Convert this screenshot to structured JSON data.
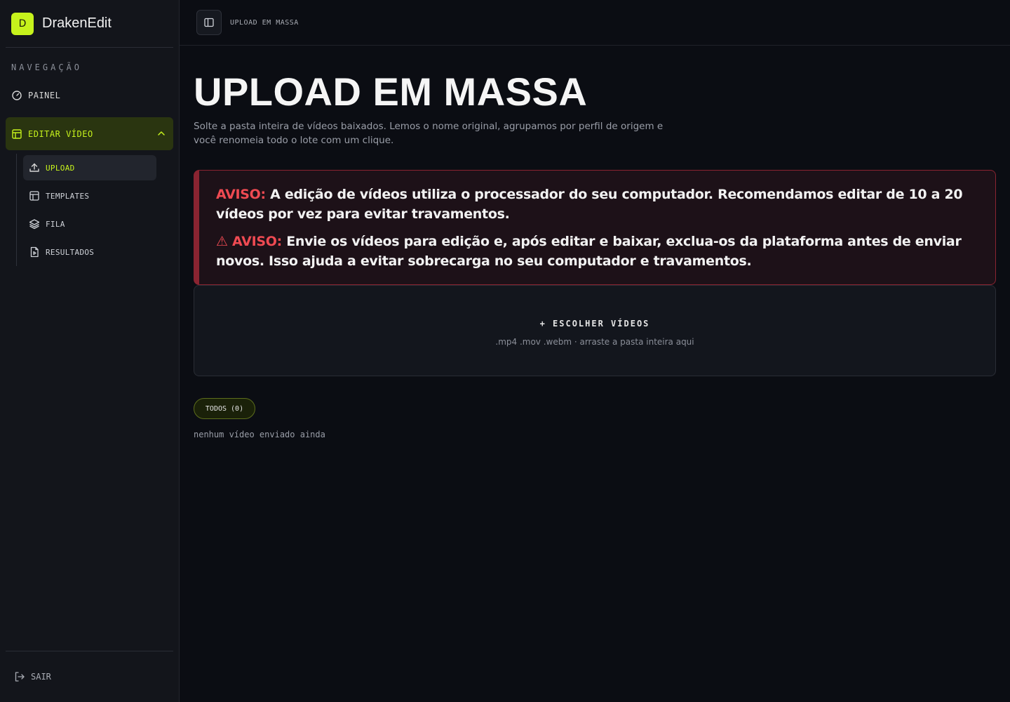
{
  "app": {
    "logo_letter": "D",
    "name": "DrakenEdit"
  },
  "sidebar": {
    "section_label": "NAVEGAÇÃO",
    "painel": "PAINEL",
    "editar": "EDITAR VÍDEO",
    "sub_items": [
      {
        "label": "UPLOAD",
        "icon": "upload-icon",
        "active": true
      },
      {
        "label": "TEMPLATES",
        "icon": "layout-icon",
        "active": false
      },
      {
        "label": "FILA",
        "icon": "layers-icon",
        "active": false
      },
      {
        "label": "RESULTADOS",
        "icon": "file-video-icon",
        "active": false
      }
    ],
    "logout": "SAIR"
  },
  "topbar": {
    "breadcrumb": "UPLOAD EM MASSA"
  },
  "main": {
    "title": "UPLOAD EM MASSA",
    "subtitle": "Solte a pasta inteira de vídeos baixados. Lemos o nome original, agrupamos por perfil de origem e você renomeia todo o lote com um clique.",
    "warning1_label": "AVISO:",
    "warning1_text": " A edição de vídeos utiliza o processador do seu computador. Recomendamos editar de 10 a 20 vídeos por vez para evitar travamentos.",
    "warning2_label": "⚠ AVISO:",
    "warning2_text": " Envie os vídeos para edição e, após editar e baixar, exclua-os da plataforma antes de enviar novos. Isso ajuda a evitar sobrecarga no seu computador e travamentos.",
    "dropzone_button": "+ ESCOLHER VÍDEOS",
    "dropzone_hint": ".mp4 .mov .webm · arraste a pasta inteira aqui",
    "filter_all": "TODOS (0)",
    "empty_message": "nenhum vídeo enviado ainda"
  },
  "colors": {
    "accent": "#c6f21c",
    "warning": "#ef4a52",
    "background": "#0b0d13"
  }
}
